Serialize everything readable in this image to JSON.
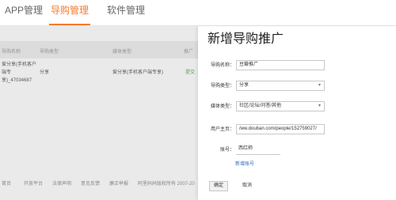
{
  "nav": {
    "tabs": [
      {
        "label": "APP管理",
        "active": false
      },
      {
        "label": "导购管理",
        "active": true
      },
      {
        "label": "软件管理",
        "active": false
      }
    ],
    "active_color": "#f47b2a"
  },
  "list": {
    "headers": [
      "导购名称",
      "导购类型",
      "媒体类型",
      "推广"
    ],
    "row": {
      "name_lines": [
        "爱分享(手机客户",
        "端专",
        "享)_47034687"
      ],
      "type": "分享",
      "media": "爱分享(手机客户端专享)",
      "action": "提交"
    }
  },
  "footer": {
    "items": [
      "首页",
      "开放平台",
      "法律声明",
      "意见反馈",
      "廉正举报",
      "阿里妈妈版权所有 2007-20"
    ]
  },
  "panel": {
    "title": "新增导购推广",
    "fields": [
      {
        "label": "导购名称：",
        "value": "豆瓣推广"
      },
      {
        "label": "导购类型：",
        "value": "分享"
      },
      {
        "label": "媒体类型：",
        "value": "社区/论坛/问答/其他"
      },
      {
        "label": "用户主页：",
        "value": "/ww.douban.com/people/152759027/"
      },
      {
        "label": "账号：",
        "value": "西红柿"
      }
    ],
    "add_account_link": "新增账号",
    "confirm_label": "确定",
    "cancel_label": "取消",
    "link_color": "#2f6fc3"
  }
}
